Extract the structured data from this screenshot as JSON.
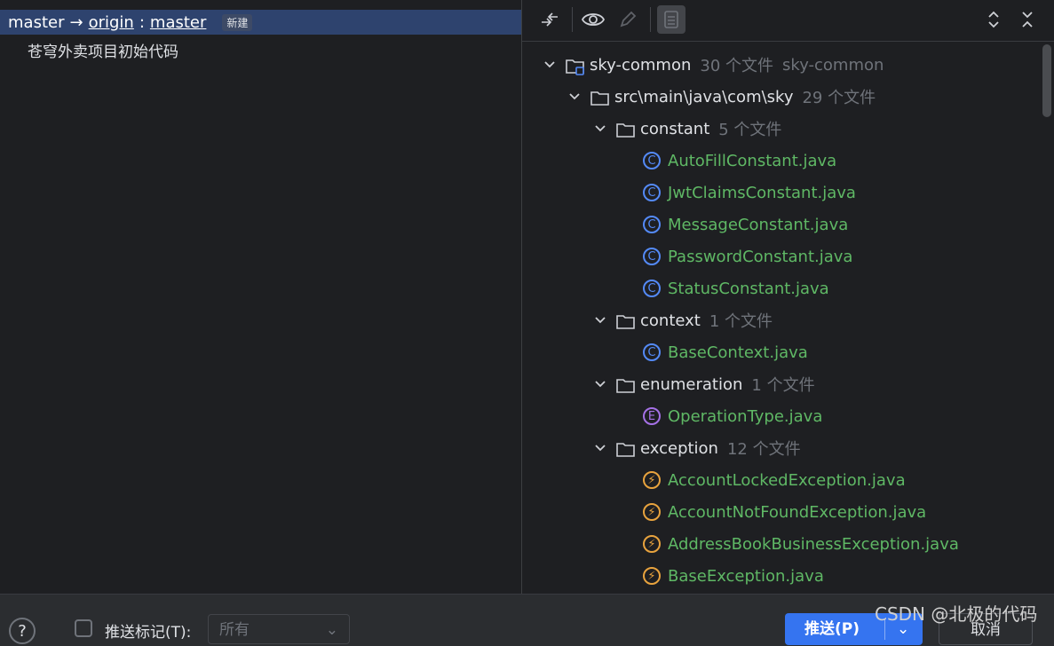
{
  "left": {
    "branch": {
      "local": "master",
      "arrow": "→",
      "remote": "origin",
      "colon": ":",
      "remote_branch": "master",
      "badge": "新建"
    },
    "commit_message": "苍穹外卖项目初始代码"
  },
  "toolbar": {
    "icons": [
      "collapse-arrows-icon",
      "eye-icon",
      "pencil-icon",
      "document-icon",
      "expand-all-icon",
      "collapse-all-icon"
    ]
  },
  "tree": {
    "root": {
      "name": "sky-common",
      "count": "30 个文件",
      "module": "sky-common"
    },
    "path": {
      "name": "src\\main\\java\\com\\sky",
      "count": "29 个文件"
    },
    "folders": [
      {
        "name": "constant",
        "count": "5 个文件"
      },
      {
        "name": "context",
        "count": "1 个文件"
      },
      {
        "name": "enumeration",
        "count": "1 个文件"
      },
      {
        "name": "exception",
        "count": "12 个文件"
      }
    ],
    "files": [
      {
        "name": "AutoFillConstant.java",
        "kind": "C"
      },
      {
        "name": "JwtClaimsConstant.java",
        "kind": "C"
      },
      {
        "name": "MessageConstant.java",
        "kind": "C"
      },
      {
        "name": "PasswordConstant.java",
        "kind": "C"
      },
      {
        "name": "StatusConstant.java",
        "kind": "C"
      },
      {
        "name": "BaseContext.java",
        "kind": "C"
      },
      {
        "name": "OperationType.java",
        "kind": "E"
      },
      {
        "name": "AccountLockedException.java",
        "kind": "exception"
      },
      {
        "name": "AccountNotFoundException.java",
        "kind": "exception"
      },
      {
        "name": "AddressBookBusinessException.java",
        "kind": "exception"
      },
      {
        "name": "BaseException.java",
        "kind": "exception"
      }
    ]
  },
  "bottom": {
    "help": "?",
    "push_tags_label": "推送标记(T):",
    "tags_select_value": "所有",
    "push_button": "推送(P)",
    "cancel_button": "取消"
  },
  "watermark": "CSDN @北极的代码",
  "colors": {
    "accent": "#3574f0",
    "file_green": "#5fb865",
    "class_icon": "#548af7",
    "enum_icon": "#a571e6",
    "exception_icon": "#e8a33e"
  }
}
